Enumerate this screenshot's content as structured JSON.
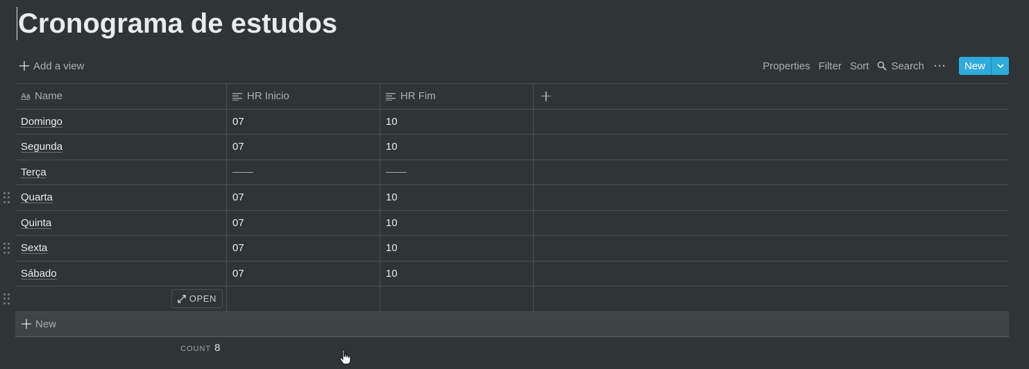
{
  "page": {
    "title": "Cronograma de estudos"
  },
  "toolbar": {
    "add_view": "Add a view",
    "properties": "Properties",
    "filter": "Filter",
    "sort": "Sort",
    "search": "Search",
    "more": "···",
    "new": "New"
  },
  "columns": {
    "name": "Name",
    "hr_inicio": "HR Inicio",
    "hr_fim": "HR Fim"
  },
  "rows": [
    {
      "name": "Domingo",
      "inicio": "07",
      "fim": "10"
    },
    {
      "name": "Segunda",
      "inicio": "07",
      "fim": "10"
    },
    {
      "name": "Terça",
      "inicio": "",
      "fim": ""
    },
    {
      "name": "Quarta",
      "inicio": "07",
      "fim": "10"
    },
    {
      "name": "Quinta",
      "inicio": "07",
      "fim": "10"
    },
    {
      "name": "Sexta",
      "inicio": "07",
      "fim": "10"
    },
    {
      "name": "Sábado",
      "inicio": "07",
      "fim": "10"
    }
  ],
  "empty_row": {
    "open": "OPEN"
  },
  "new_row": {
    "label": "New"
  },
  "footer": {
    "count_label": "COUNT",
    "count_value": "8"
  },
  "colors": {
    "accent": "#2eaadc",
    "background": "#2f3437",
    "new_row_bg": "#3f4447"
  }
}
